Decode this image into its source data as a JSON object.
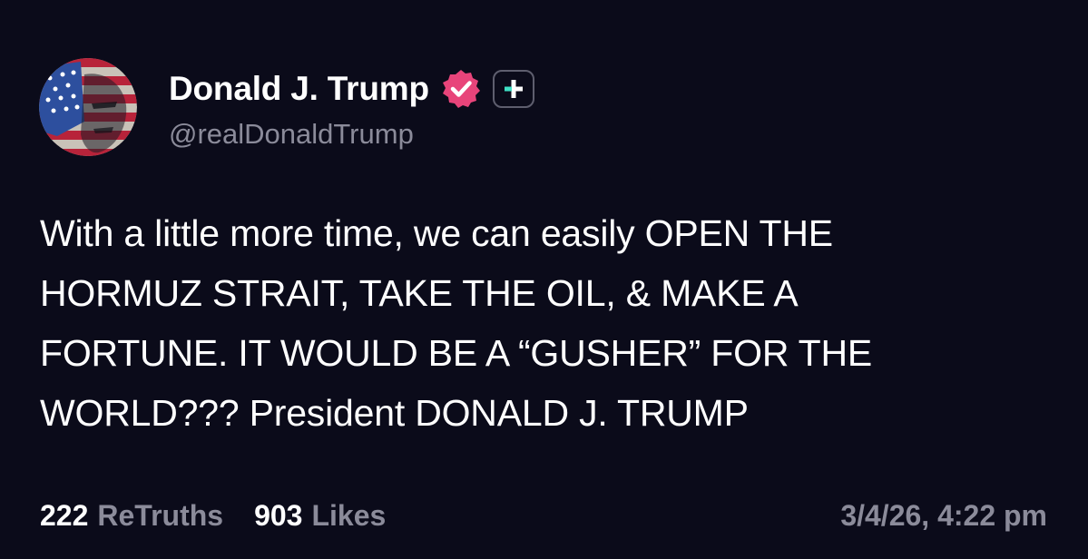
{
  "user": {
    "display_name": "Donald J. Trump",
    "handle": "@realDonaldTrump",
    "verified_icon": "verified-badge-icon",
    "plus_icon": "plus-badge-icon",
    "badge_color": "#e8447a",
    "plus_accent_color": "#3fe0c5"
  },
  "post": {
    "lines": [
      "With a little more time, we can easily OPEN THE",
      "HORMUZ STRAIT, TAKE THE OIL, & MAKE A",
      "FORTUNE. IT WOULD BE A “GUSHER” FOR THE",
      "WORLD??? President DONALD J. TRUMP"
    ]
  },
  "stats": {
    "retruths_count": "222",
    "retruths_label": "ReTruths",
    "likes_count": "903",
    "likes_label": "Likes",
    "timestamp": "3/4/26, 4:22 pm"
  },
  "colors": {
    "background": "#0b0b1a",
    "text_primary": "#ffffff",
    "text_secondary": "#8b8b9a"
  }
}
